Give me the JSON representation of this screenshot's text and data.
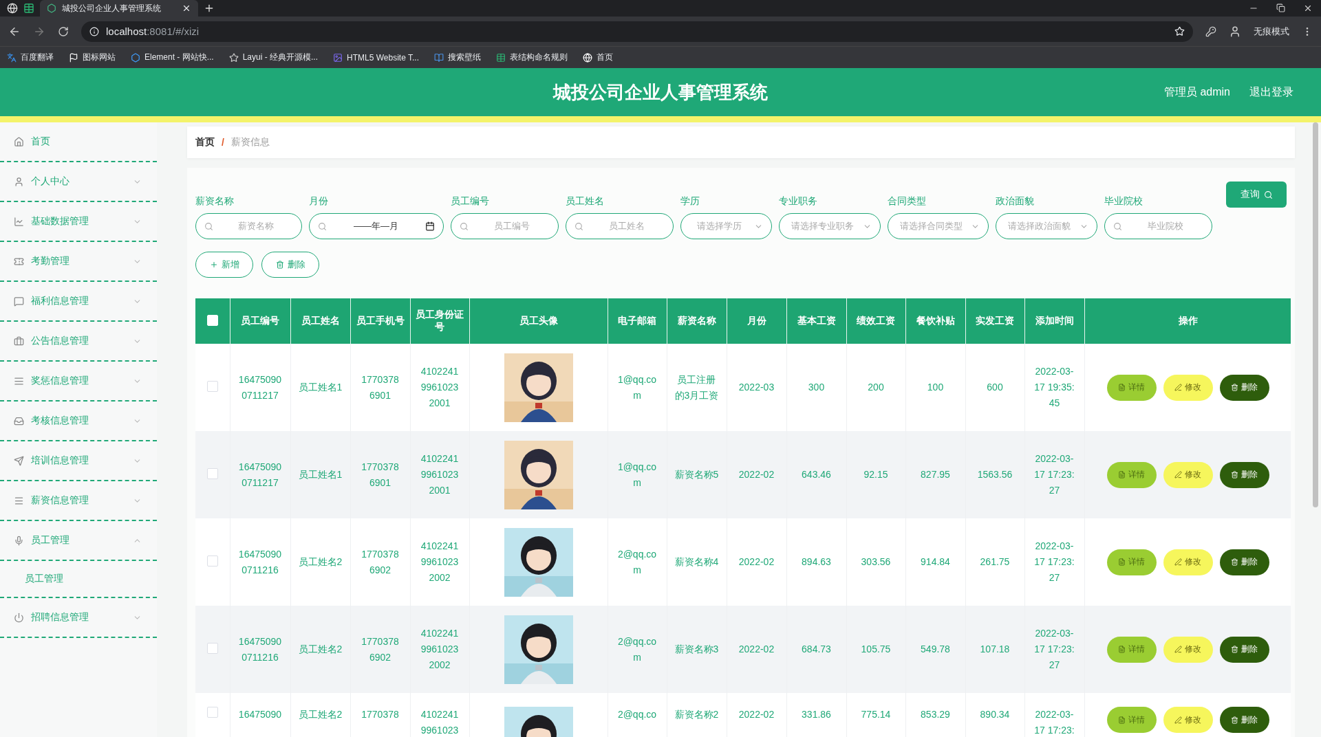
{
  "browser": {
    "tabs": [
      {
        "title": "城投公司企业人事管理系统",
        "selected": true
      }
    ],
    "address": {
      "host": "localhost",
      "rest": ":8081/#/xizi"
    },
    "incognito_label": "无痕模式",
    "bookmarks": [
      "百度翻译",
      "图标网站",
      "Element - 网站快...",
      "Layui - 经典开源模...",
      "HTML5 Website T...",
      "搜索壁纸",
      "表结构命名规则",
      "首页"
    ]
  },
  "header": {
    "title": "城投公司企业人事管理系统",
    "user": "管理员 admin",
    "logout": "退出登录"
  },
  "sidebar": {
    "items": [
      {
        "label": "首页"
      },
      {
        "label": "个人中心",
        "expanded": false
      },
      {
        "label": "基础数据管理",
        "expanded": false
      },
      {
        "label": "考勤管理",
        "expanded": false
      },
      {
        "label": "福利信息管理",
        "expanded": false
      },
      {
        "label": "公告信息管理",
        "expanded": false
      },
      {
        "label": "奖惩信息管理",
        "expanded": false
      },
      {
        "label": "考核信息管理",
        "expanded": false
      },
      {
        "label": "培训信息管理",
        "expanded": false
      },
      {
        "label": "薪资信息管理",
        "expanded": false
      },
      {
        "label": "员工管理",
        "expanded": true,
        "children": [
          {
            "label": "员工管理"
          }
        ]
      },
      {
        "label": "招聘信息管理",
        "expanded": false
      }
    ]
  },
  "breadcrumb": {
    "items": [
      "首页",
      "薪资信息"
    ],
    "separator": "/"
  },
  "filters": [
    {
      "label": "薪资名称",
      "kind": "text",
      "placeholder": "薪资名称"
    },
    {
      "label": "月份",
      "kind": "month",
      "placeholder": "——年—月"
    },
    {
      "label": "员工编号",
      "kind": "text",
      "placeholder": "员工编号"
    },
    {
      "label": "员工姓名",
      "kind": "text",
      "placeholder": "员工姓名"
    },
    {
      "label": "学历",
      "kind": "select",
      "placeholder": "请选择学历"
    },
    {
      "label": "专业职务",
      "kind": "select",
      "placeholder": "请选择专业职务"
    },
    {
      "label": "合同类型",
      "kind": "select",
      "placeholder": "请选择合同类型"
    },
    {
      "label": "政治面貌",
      "kind": "select",
      "placeholder": "请选择政治面貌"
    },
    {
      "label": "毕业院校",
      "kind": "text",
      "placeholder": "毕业院校"
    }
  ],
  "query_button": "查询",
  "actions": [
    {
      "label": "新增",
      "kind": "add"
    },
    {
      "label": "删除",
      "kind": "delete"
    }
  ],
  "table": {
    "header_checked": false,
    "columns": [
      "员工编号",
      "员工姓名",
      "员工手机号",
      "员工身份证号",
      "员工头像",
      "电子邮箱",
      "薪资名称",
      "月份",
      "基本工资",
      "绩效工资",
      "餐饮补贴",
      "实发工资",
      "添加时间",
      "操作"
    ],
    "rows": [
      {
        "checked": false,
        "cells": [
          "164750900711217",
          "员工姓名1",
          "17703786901",
          "410224199610232001",
          {
            "kind": "picture"
          },
          "1@qq.com",
          "员工注册的3月工资",
          "2022-03",
          "300",
          "200",
          "100",
          "600",
          "2022-03-17 19:35:45"
        ],
        "buttons": [
          {
            "label": "详情",
            "kind": "details"
          },
          {
            "label": "修改",
            "kind": "edit"
          },
          {
            "label": "删除",
            "kind": "delete"
          }
        ]
      },
      {
        "checked": false,
        "cells": [
          "164750900711217",
          "员工姓名1",
          "17703786901",
          "410224199610232001",
          {
            "kind": "picture"
          },
          "1@qq.com",
          "薪资名称5",
          "2022-02",
          "643.46",
          "92.15",
          "827.95",
          "1563.56",
          "2022-03-17 17:23:27"
        ],
        "buttons": [
          {
            "label": "详情",
            "kind": "details"
          },
          {
            "label": "修改",
            "kind": "edit"
          },
          {
            "label": "删除",
            "kind": "delete"
          }
        ]
      },
      {
        "checked": false,
        "cells": [
          "164750900711216",
          "员工姓名2",
          "17703786902",
          "410224199610232002",
          {
            "kind": "picture"
          },
          "2@qq.com",
          "薪资名称4",
          "2022-02",
          "894.63",
          "303.56",
          "914.84",
          "261.75",
          "2022-03-17 17:23:27"
        ],
        "buttons": [
          {
            "label": "详情",
            "kind": "details"
          },
          {
            "label": "修改",
            "kind": "edit"
          },
          {
            "label": "删除",
            "kind": "delete"
          }
        ]
      },
      {
        "checked": false,
        "cells": [
          "164750900711216",
          "员工姓名2",
          "17703786902",
          "410224199610232002",
          {
            "kind": "picture"
          },
          "2@qq.com",
          "薪资名称3",
          "2022-02",
          "684.73",
          "105.75",
          "549.78",
          "107.18",
          "2022-03-17 17:23:27"
        ],
        "buttons": [
          {
            "label": "详情",
            "kind": "details"
          },
          {
            "label": "修改",
            "kind": "edit"
          },
          {
            "label": "删除",
            "kind": "delete"
          }
        ]
      },
      {
        "checked": false,
        "cells": [
          "16475090",
          "员工姓名2",
          "1770378",
          "41022419961023",
          {
            "kind": "picture"
          },
          "2@qq.co",
          "薪资名称2",
          "2022-02",
          "331.86",
          "775.14",
          "853.29",
          "890.34",
          "2022-03-17 17:23:"
        ],
        "buttons": [
          {
            "label": "详情",
            "kind": "details"
          },
          {
            "label": "修改",
            "kind": "edit"
          },
          {
            "label": "删除",
            "kind": "delete"
          }
        ]
      }
    ]
  }
}
